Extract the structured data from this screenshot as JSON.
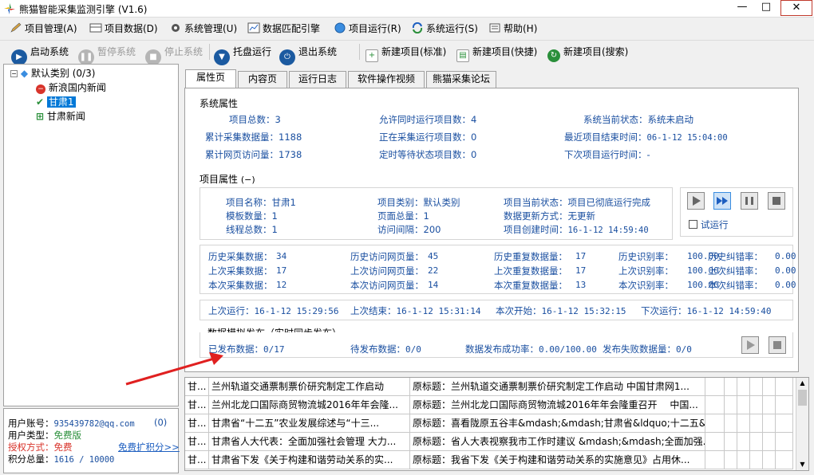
{
  "window": {
    "title": "熊猫智能采集监测引擎 (V1.6)",
    "min": "—",
    "max": "□",
    "close": "✕"
  },
  "menu": [
    "项目管理(A)",
    "项目数据(D)",
    "系统管理(U)",
    "数据匹配引擎",
    "项目运行(R)",
    "系统运行(S)",
    "帮助(H)"
  ],
  "toolbar": {
    "start": "启动系统",
    "pause": "暂停系统",
    "stop": "停止系统",
    "tray": "托盘运行",
    "exit": "退出系统",
    "new_std": "新建项目(标准)",
    "new_fast": "新建项目(快捷)",
    "new_search": "新建项目(搜索)"
  },
  "tree": {
    "root": "默认类别 (0/3)",
    "items": [
      "新浪国内新闻",
      "甘肃1",
      "甘肃新闻"
    ]
  },
  "user": {
    "account_label": "用户账号：",
    "account": "935439782@qq.com",
    "account_count": "(0)",
    "type_label": "用户类型：",
    "type": "免费版",
    "auth_label": "授权方式：",
    "auth": "免费",
    "points_label": "积分总量：",
    "points": "1616 / 10000",
    "expand_link": "免费扩积分>>"
  },
  "tabs": [
    "属性页",
    "内容页",
    "运行日志",
    "软件操作视频",
    "熊猫采集论坛"
  ],
  "system": {
    "heading": "系统属性",
    "total_projects_label": "项目总数：",
    "total_projects": "3",
    "allow_concurrent_label": "允许同时运行项目数：",
    "allow_concurrent": "4",
    "status_label": "系统当前状态：",
    "status": "系统未启动",
    "total_collected_label": "累计采集数据量：",
    "total_collected": "1188",
    "running_label": "正在采集运行项目数：",
    "running": "0",
    "last_end_label": "最近项目结束时间：",
    "last_end": "06-1-12 15:04:00",
    "page_visits_label": "累计网页访问量：",
    "page_visits": "1738",
    "waiting_label": "定时等待状态项目数：",
    "waiting": "0",
    "next_run_label": "下次项目运行时间：",
    "next_run": "-"
  },
  "project": {
    "heading": "项目属性",
    "collapse": "(−)",
    "name_label": "项目名称：",
    "name": "甘肃1",
    "category_label": "项目类别：",
    "category": "默认类别",
    "state_label": "项目当前状态：",
    "state": "项目已彻底运行完成",
    "templates_label": "模板数量：",
    "templates": "1",
    "pages_label": "页面总量：",
    "pages": "1",
    "update_label": "数据更新方式：",
    "update": "无更新",
    "threads_label": "线程总数：",
    "threads": "1",
    "interval_label": "访问间隔：",
    "interval": "200",
    "created_label": "项目创建时间：",
    "created": "16-1-12 14:59:40",
    "trial_label": "试运行"
  },
  "stats": {
    "row1": [
      "历史采集数据：",
      "34",
      "历史访问网页量：",
      "45",
      "历史重复数据量：",
      "17",
      "历史识别率：",
      "100.00",
      "历史纠错率：",
      "0.00"
    ],
    "row2": [
      "上次采集数据：",
      "17",
      "上次访问网页量：",
      "22",
      "上次重复数据量：",
      "17",
      "上次识别率：",
      "100.00",
      "上次纠错率：",
      "0.00"
    ],
    "row3": [
      "本次采集数据：",
      "12",
      "本次访问网页量：",
      "14",
      "本次重复数据量：",
      "13",
      "本次识别率：",
      "100.00",
      "本次纠错率：",
      "0.00"
    ]
  },
  "times": {
    "last_run_label": "上次运行：",
    "last_run": "16-1-12 15:29:56",
    "last_end_label": "上次结束：",
    "last_end": "16-1-12 15:31:14",
    "this_start_label": "本次开始：",
    "this_start": "16-1-12 15:32:15",
    "next_label": "下次运行：",
    "next": "16-1-12 14:59:40"
  },
  "publish": {
    "heading": "数据模拟发布（实时同步发布）",
    "published_label": "已发布数据：",
    "published": "0/17",
    "pending_label": "待发布数据：",
    "pending": "0/0",
    "rate_label": "数据发布成功率：",
    "rate": "0.00/100.00",
    "fail_label": "发布失败数据量：",
    "fail": "0/0"
  },
  "rows": [
    [
      "甘...",
      "兰州轨道交通票制票价研究制定工作启动",
      "原标题：兰州轨道交通票制票价研究制定工作启动 中国甘肃网1..."
    ],
    [
      "甘...",
      "兰州北龙口国际商贸物流城2016年年会隆...",
      "原标题：兰州北龙口国际商贸物流城2016年年会隆重召开 　中国..."
    ],
    [
      "甘...",
      "甘肃省“十二五”农业发展综述与“十三...",
      "原标题：喜看陇原五谷丰&mdash;&mdash;甘肃省&ldquo;十二五&r..."
    ],
    [
      "甘...",
      "甘肃省人大代表：全面加强社会管理 大力...",
      "原标题：省人大表视察我市工作时建议 &mdash;&mdash;全面加强..."
    ],
    [
      "甘...",
      "甘肃省下发《关于构建和谐劳动关系的实...",
      "原标题：我省下发《关于构建和谐劳动关系的实施意见》占用休..."
    ]
  ]
}
